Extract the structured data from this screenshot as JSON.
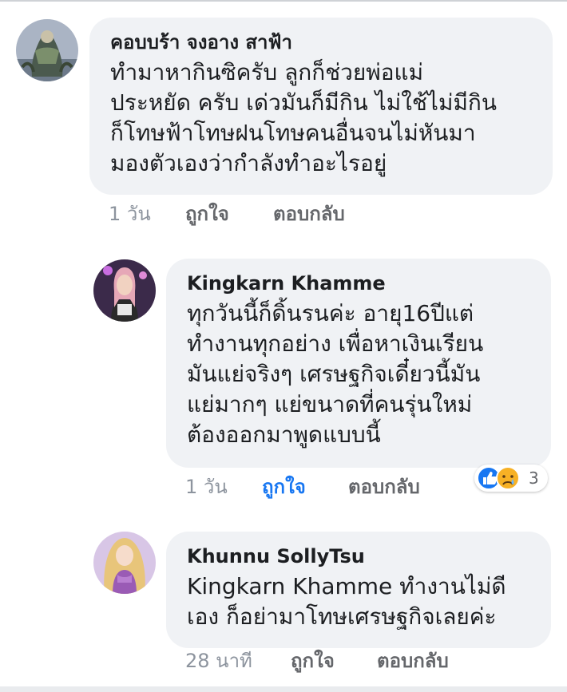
{
  "comments": [
    {
      "author": "คอบบร้า จงอาง สาฟ้า",
      "lines": [
        "ทำมาหากินซิครับ ลูกก็ช่วยพ่อแม่",
        "ประหยัด ครับ เด่วมันก็มีกิน ไม่ใช้ไม่มีกิน",
        "ก็โทษฟ้าโทษฝนโทษคนอื่นจนไม่หันมา",
        "มองตัวเองว่ากำลังทำอะไรอยู่"
      ],
      "time": "1 วัน",
      "like_label": "ถูกใจ",
      "reply_label": "ตอบกลับ"
    },
    {
      "author": "Kingkarn Khamme",
      "lines": [
        "ทุกวันนี้ก็ดิ้นรนค่ะ อายุ16ปีแต่",
        "ทำงานทุกอย่าง เพื่อหาเงินเรียน",
        "มันแย่จริงๆ เศรษฐกิจเดี๋ยวนี้มัน",
        "แย่มากๆ แย่ขนาดที่คนรุ่นใหม่",
        "ต้องออกมาพูดแบบนี้"
      ],
      "time": "1 วัน",
      "like_label": "ถูกใจ",
      "reply_label": "ตอบกลับ",
      "reactions": {
        "icons": [
          "like-icon",
          "sad-icon"
        ],
        "count": "3"
      }
    },
    {
      "author": "Khunnu SollyTsu",
      "lines": [
        "Kingkarn Khamme ทำงานไม่ดี",
        "เอง ก็อย่ามาโทษเศรษฐกิจเลยค่ะ"
      ],
      "time": "28 นาที",
      "like_label": "ถูกใจ",
      "reply_label": "ตอบกลับ"
    }
  ],
  "colors": {
    "bubble": "#f0f2f5",
    "liked": "#1877f2",
    "like_reaction": "#1877f2",
    "sad_reaction": "#f7b125"
  }
}
